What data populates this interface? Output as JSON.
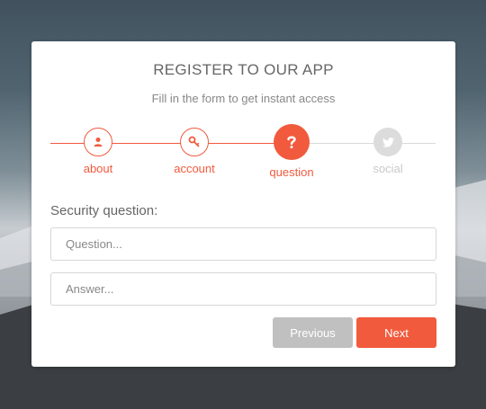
{
  "form": {
    "title": "REGISTER TO OUR APP",
    "subtitle": "Fill in the form to get instant access",
    "steps": [
      {
        "label": "about",
        "icon": "user-icon",
        "state": "done"
      },
      {
        "label": "account",
        "icon": "key-icon",
        "state": "done"
      },
      {
        "label": "question",
        "icon": "question-icon",
        "state": "active"
      },
      {
        "label": "social",
        "icon": "twitter-icon",
        "state": "pending"
      }
    ],
    "section_label": "Security question:",
    "question_placeholder": "Question...",
    "question_value": "",
    "answer_placeholder": "Answer...",
    "answer_value": "",
    "previous_label": "Previous",
    "next_label": "Next"
  },
  "colors": {
    "accent": "#f15a3d",
    "disabled": "#c0c0c0",
    "pending": "#dcdcdc"
  }
}
